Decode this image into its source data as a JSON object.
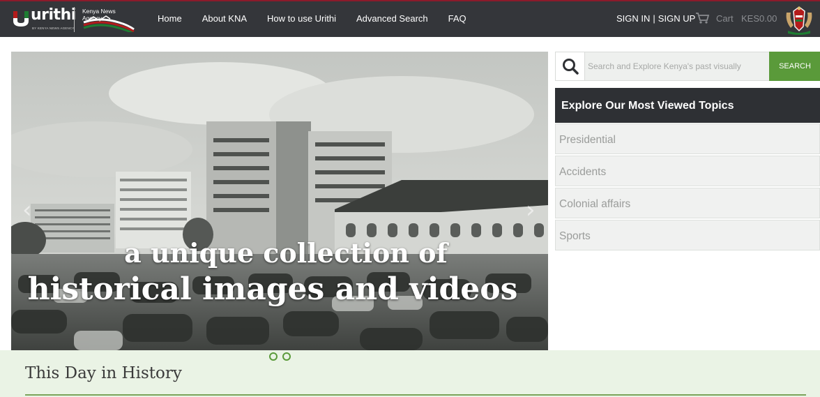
{
  "brand": {
    "name": "urithi",
    "tagline": "BY KENYA NEWS AGENCY",
    "partner": "Kenya News Agency",
    "flag_colors": [
      "#000000",
      "#b31b1b",
      "#1e7d32",
      "#ffffff"
    ]
  },
  "nav": {
    "items": [
      {
        "label": "Home"
      },
      {
        "label": "About KNA"
      },
      {
        "label": "How to use Urithi"
      },
      {
        "label": "Advanced Search"
      },
      {
        "label": "FAQ"
      }
    ],
    "sign_in": "SIGN IN",
    "divider": "|",
    "sign_up": "SIGN UP",
    "cart_label": "Cart",
    "cart_amount": "KES0.00",
    "cart_icon": "cart-icon",
    "coat_icon": "coat-of-arms-icon"
  },
  "hero": {
    "caption_line1": "a unique collection of",
    "caption_line2": "historical images and videos",
    "prev_icon": "chevron-left-icon",
    "next_icon": "chevron-right-icon",
    "slide_count": 2
  },
  "search": {
    "placeholder": "Search and Explore Kenya's past visually",
    "button_label": "SEARCH",
    "icon": "search-icon"
  },
  "topics": {
    "header": "Explore Our Most Viewed Topics",
    "items": [
      "Presidential",
      "Accidents",
      "Colonial affairs",
      "Sports"
    ]
  },
  "history": {
    "title": "This Day in History"
  },
  "colors": {
    "navbar": "#34363a",
    "accent_green": "#5a9a3a",
    "topics_header": "#2e3034",
    "history_bg": "#eaf3e5"
  }
}
